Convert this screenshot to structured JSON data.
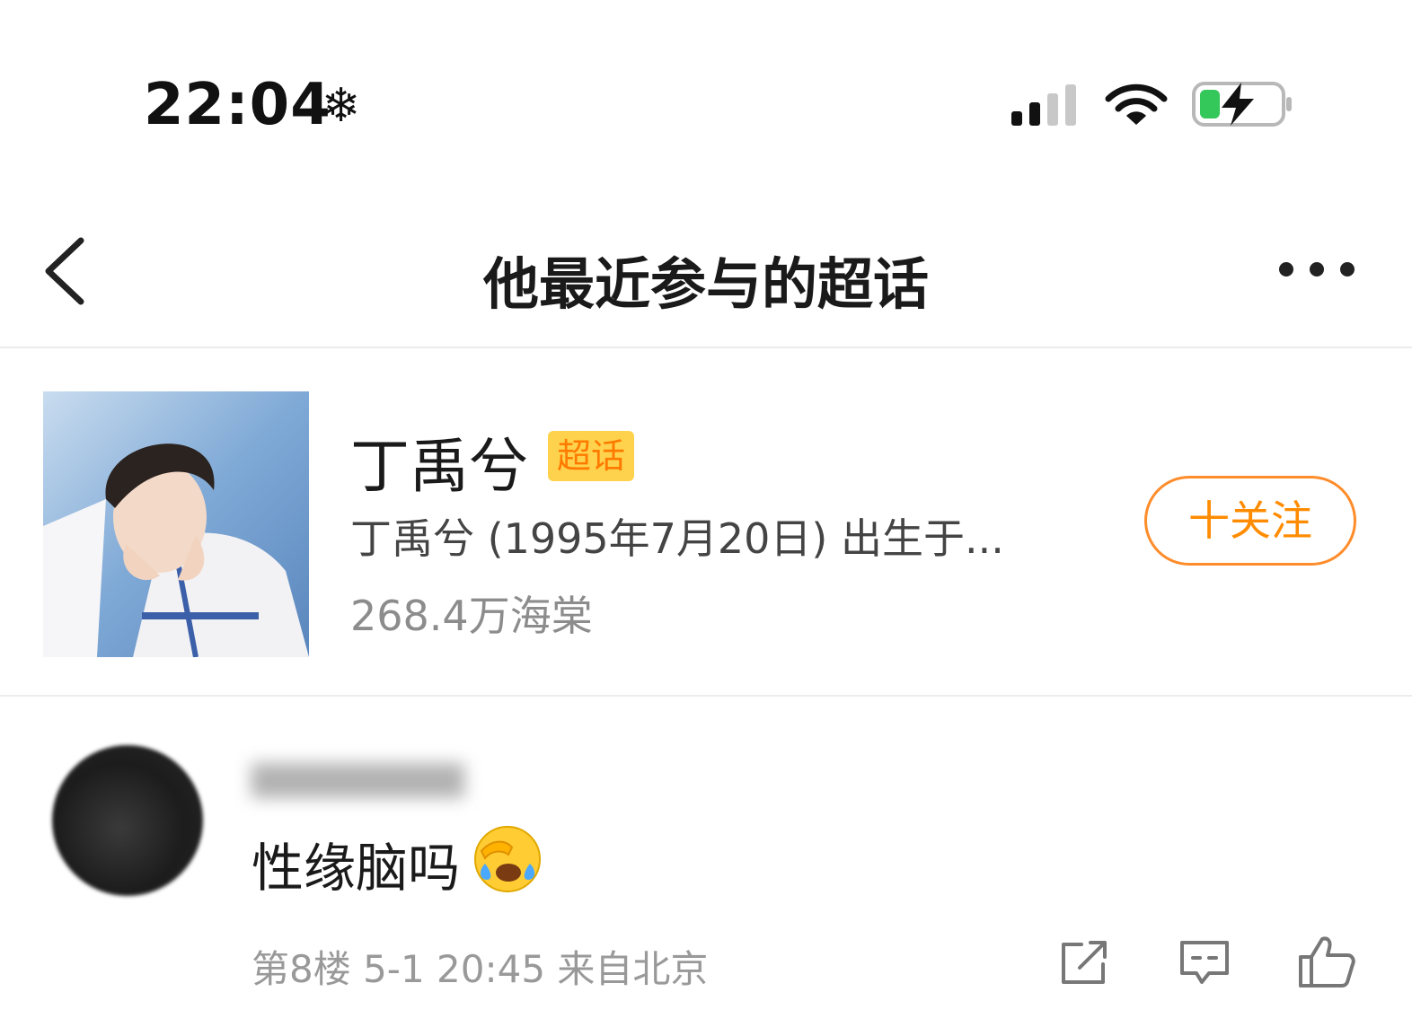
{
  "status_bar": {
    "time": "22:04",
    "extra_icon": "❄",
    "icons": [
      "signal-icon",
      "wifi-icon",
      "battery-charging-icon"
    ]
  },
  "nav": {
    "back_icon": "chevron-left-icon",
    "title": "他最近参与的超话",
    "more_icon": "more-dots-icon"
  },
  "topic": {
    "name": "丁禹兮",
    "badge": "超话",
    "description": "丁禹兮 (1995年7月20日) 出生于...",
    "fans": "268.4万海棠",
    "follow_label": "十关注"
  },
  "comment": {
    "text": "性缘脑吗",
    "emoji": "facepalm-crying-emoji",
    "meta": "第8楼 5-1 20:45 来自北京",
    "actions": [
      "share-icon",
      "comment-icon",
      "like-icon"
    ]
  },
  "colors": {
    "accent_orange": "#ff8c00",
    "badge_yellow": "#ffd24d",
    "battery_green": "#34c759"
  }
}
